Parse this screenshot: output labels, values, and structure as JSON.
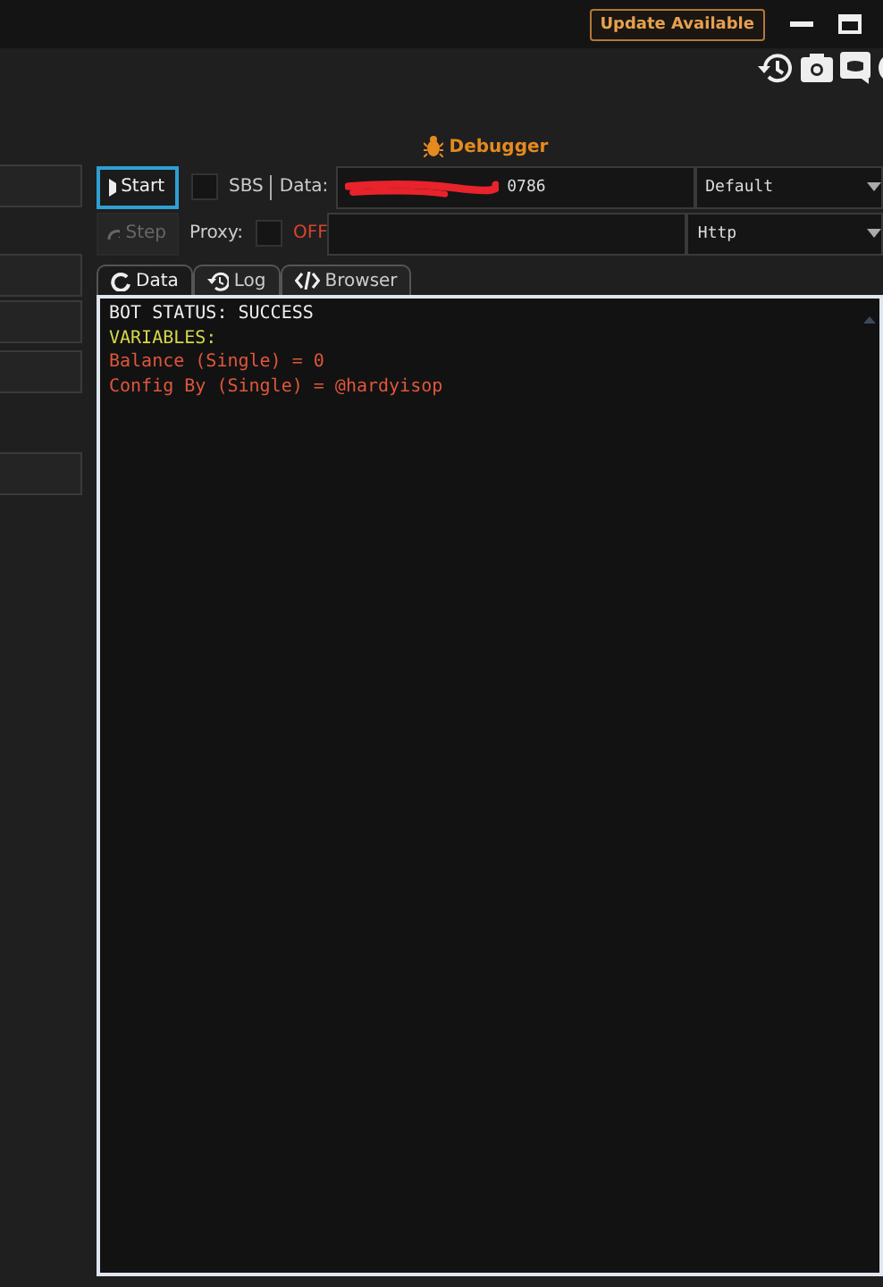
{
  "title_bar": {
    "update_button": "Update Available"
  },
  "debugger": {
    "title": "Debugger",
    "start_button": {
      "label": "Start",
      "focused": true
    },
    "sbs": {
      "label": "SBS",
      "checked": false
    },
    "data_label": "Data:",
    "data_value": "0786",
    "config_dropdown": {
      "value": "Default"
    },
    "step_button": {
      "label": "Step",
      "disabled": true
    },
    "proxy": {
      "label": "Proxy:",
      "checked": false,
      "status": "OFF"
    },
    "proxy_type_dropdown": {
      "value": "Http"
    },
    "tabs": [
      {
        "label": "Data",
        "selected": true,
        "kind": "data"
      },
      {
        "label": "Log",
        "selected": false,
        "kind": "log"
      },
      {
        "label": "Browser",
        "selected": false,
        "kind": "browser"
      }
    ],
    "console_lines": [
      {
        "text": "BOT STATUS: SUCCESS",
        "kind": "status"
      },
      {
        "text": "VARIABLES:",
        "kind": "header"
      },
      {
        "text": "Balance (Single) = 0",
        "kind": "variable"
      },
      {
        "text": "Config By (Single) = @hardyisop",
        "kind": "variable"
      }
    ]
  }
}
